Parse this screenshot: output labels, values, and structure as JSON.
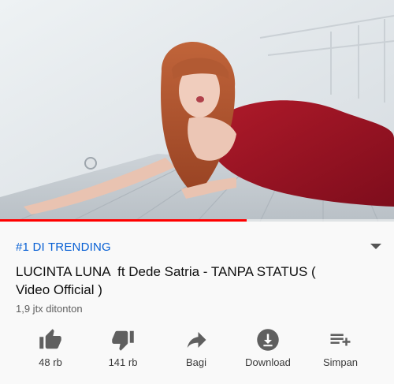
{
  "player": {
    "progress_fraction": 0.625
  },
  "video": {
    "trending_label": "#1 DI TRENDING",
    "title": "LUCINTA LUNA  ft Dede Satria - TANPA STATUS ( Video Official )",
    "views": "1,9 jtx ditonton"
  },
  "actions": {
    "like_count": "48 rb",
    "dislike_count": "141 rb",
    "share_label": "Bagi",
    "download_label": "Download",
    "save_label": "Simpan"
  },
  "icons": {
    "like": "thumb-up-icon",
    "dislike": "thumb-down-icon",
    "share": "share-arrow-icon",
    "download": "download-icon",
    "save": "playlist-add-icon",
    "expand": "chevron-down-icon"
  },
  "colors": {
    "trending": "#065fd4",
    "progress": "#ff0000",
    "icon": "#5f5f5f"
  }
}
